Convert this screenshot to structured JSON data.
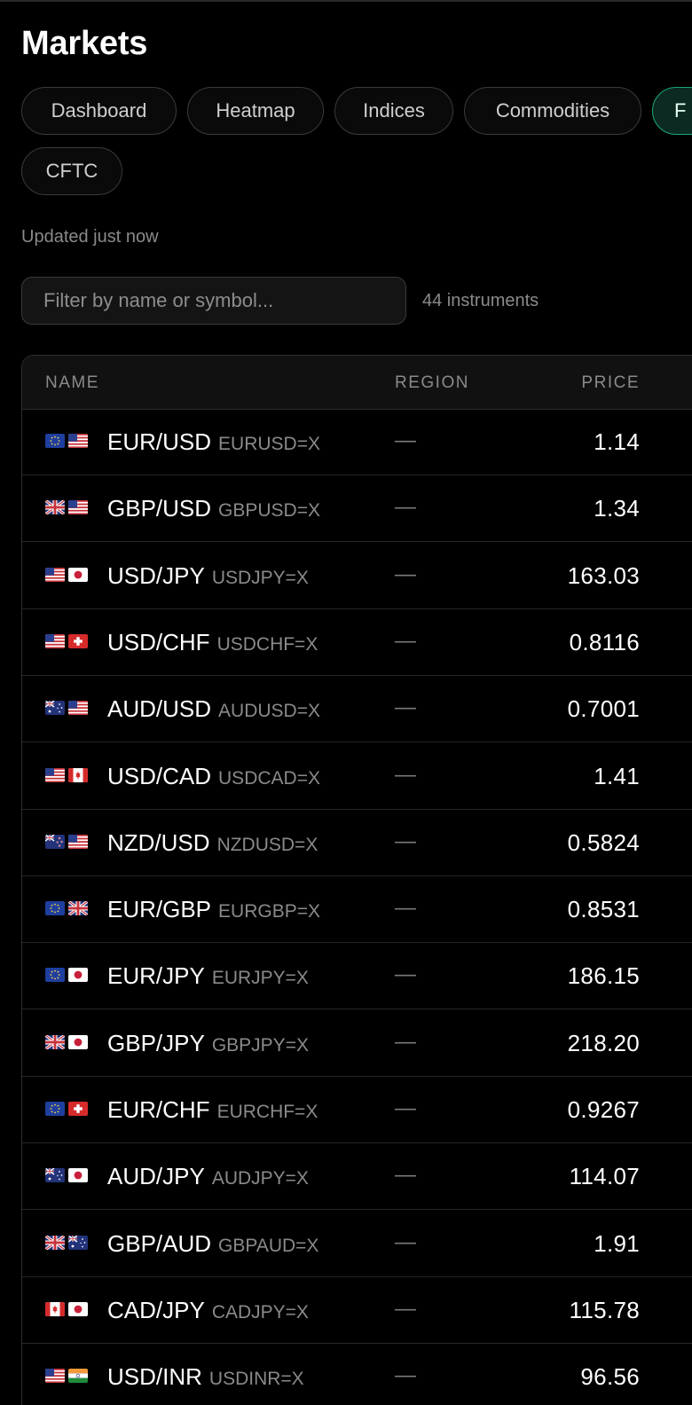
{
  "page": {
    "title": "Markets"
  },
  "tabs": [
    {
      "label": "Dashboard",
      "active": false
    },
    {
      "label": "Heatmap",
      "active": false
    },
    {
      "label": "Indices",
      "active": false
    },
    {
      "label": "Commodities",
      "active": false
    },
    {
      "label": "F",
      "active": true
    },
    {
      "label": "CFTC",
      "active": false
    }
  ],
  "status": {
    "updated": "Updated just now"
  },
  "filter": {
    "placeholder": "Filter by name or symbol...",
    "value": ""
  },
  "instruments": {
    "count_label": "44 instruments"
  },
  "table": {
    "headers": {
      "name": "NAME",
      "region": "REGION",
      "price": "PRICE"
    },
    "rows": [
      {
        "flags": [
          "eu-flag-icon",
          "us-flag-icon"
        ],
        "name": "EUR/USD",
        "symbol": "EURUSD=X",
        "region": "—",
        "price": "1.14"
      },
      {
        "flags": [
          "gb-flag-icon",
          "us-flag-icon"
        ],
        "name": "GBP/USD",
        "symbol": "GBPUSD=X",
        "region": "—",
        "price": "1.34"
      },
      {
        "flags": [
          "us-flag-icon",
          "jp-flag-icon"
        ],
        "name": "USD/JPY",
        "symbol": "USDJPY=X",
        "region": "—",
        "price": "163.03"
      },
      {
        "flags": [
          "us-flag-icon",
          "ch-flag-icon"
        ],
        "name": "USD/CHF",
        "symbol": "USDCHF=X",
        "region": "—",
        "price": "0.8116"
      },
      {
        "flags": [
          "au-flag-icon",
          "us-flag-icon"
        ],
        "name": "AUD/USD",
        "symbol": "AUDUSD=X",
        "region": "—",
        "price": "0.7001"
      },
      {
        "flags": [
          "us-flag-icon",
          "ca-flag-icon"
        ],
        "name": "USD/CAD",
        "symbol": "USDCAD=X",
        "region": "—",
        "price": "1.41"
      },
      {
        "flags": [
          "nz-flag-icon",
          "us-flag-icon"
        ],
        "name": "NZD/USD",
        "symbol": "NZDUSD=X",
        "region": "—",
        "price": "0.5824"
      },
      {
        "flags": [
          "eu-flag-icon",
          "gb-flag-icon"
        ],
        "name": "EUR/GBP",
        "symbol": "EURGBP=X",
        "region": "—",
        "price": "0.8531"
      },
      {
        "flags": [
          "eu-flag-icon",
          "jp-flag-icon"
        ],
        "name": "EUR/JPY",
        "symbol": "EURJPY=X",
        "region": "—",
        "price": "186.15"
      },
      {
        "flags": [
          "gb-flag-icon",
          "jp-flag-icon"
        ],
        "name": "GBP/JPY",
        "symbol": "GBPJPY=X",
        "region": "—",
        "price": "218.20"
      },
      {
        "flags": [
          "eu-flag-icon",
          "ch-flag-icon"
        ],
        "name": "EUR/CHF",
        "symbol": "EURCHF=X",
        "region": "—",
        "price": "0.9267"
      },
      {
        "flags": [
          "au-flag-icon",
          "jp-flag-icon"
        ],
        "name": "AUD/JPY",
        "symbol": "AUDJPY=X",
        "region": "—",
        "price": "114.07"
      },
      {
        "flags": [
          "gb-flag-icon",
          "au-flag-icon"
        ],
        "name": "GBP/AUD",
        "symbol": "GBPAUD=X",
        "region": "—",
        "price": "1.91"
      },
      {
        "flags": [
          "ca-flag-icon",
          "jp-flag-icon"
        ],
        "name": "CAD/JPY",
        "symbol": "CADJPY=X",
        "region": "—",
        "price": "115.78"
      },
      {
        "flags": [
          "us-flag-icon",
          "in-flag-icon"
        ],
        "name": "USD/INR",
        "symbol": "USDINR=X",
        "region": "—",
        "price": "96.56"
      }
    ]
  },
  "colors": {
    "background": "#000000",
    "accent": "#1aa67a",
    "muted_text": "#8a8a8a",
    "border": "#2e2e2e"
  }
}
